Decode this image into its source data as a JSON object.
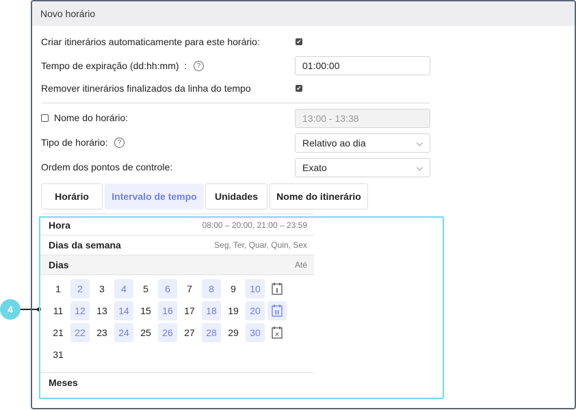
{
  "panel": {
    "title": "Novo horário"
  },
  "form": {
    "auto_create_label": "Criar itinerários automaticamente para este horário:",
    "auto_create_checked": true,
    "expiration_label": "Tempo de expiração (dd:hh:mm)",
    "expiration_colon": ":",
    "expiration_value": "01:00:00",
    "remove_label": "Remover itinerários finalizados da linha do tempo",
    "remove_checked": true,
    "name_label": "Nome do horário:",
    "name_checked": false,
    "name_value": "13:00 - 13:38",
    "type_label": "Tipo de horário:",
    "type_value": "Relativo ao dia",
    "order_label": "Ordem dos pontos de controle:",
    "order_value": "Exato"
  },
  "tabs": [
    {
      "label": "Horário"
    },
    {
      "label": "Intervalo de tempo",
      "active": true
    },
    {
      "label": "Unidades"
    },
    {
      "label": "Nome do itinerário"
    }
  ],
  "interval": {
    "hour_label": "Hora",
    "hour_value": "08:00 – 20:00, 21:00 – 23:59",
    "weekdays_label": "Dias da semana",
    "weekdays_value": "Seg, Ter, Quar, Quin, Sex",
    "days_label": "Dias",
    "days_value": "Até",
    "days": [
      1,
      2,
      3,
      4,
      5,
      6,
      7,
      8,
      9,
      10,
      11,
      12,
      13,
      14,
      15,
      16,
      17,
      18,
      19,
      20,
      21,
      22,
      23,
      24,
      25,
      26,
      27,
      28,
      29,
      30,
      31
    ],
    "selected_days": [
      2,
      4,
      6,
      8,
      10,
      12,
      14,
      16,
      18,
      20,
      22,
      24,
      26,
      28,
      30
    ],
    "months_label": "Meses"
  },
  "callout": {
    "number": "4"
  },
  "colors": {
    "accent": "#6f7fe6",
    "highlight": "#6fdcec"
  }
}
